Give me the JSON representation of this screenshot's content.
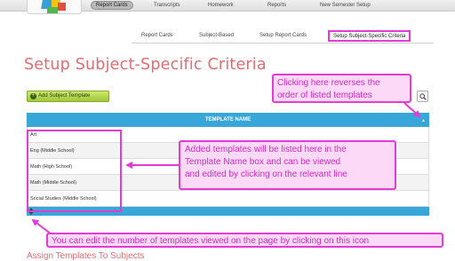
{
  "nav": {
    "items": [
      {
        "label": "Report Cards",
        "active": true
      },
      {
        "label": "Transcripts",
        "active": false
      },
      {
        "label": "Homework",
        "active": false
      },
      {
        "label": "Reports",
        "active": false
      },
      {
        "label": "New Semester Setup",
        "active": false
      }
    ]
  },
  "subnav": {
    "items": [
      {
        "label": "Report Cards",
        "active": false
      },
      {
        "label": "Subject-Based",
        "active": false
      },
      {
        "label": "Setup Report Cards",
        "active": false
      },
      {
        "label": "Setup Subject-Specific Criteria",
        "active": true
      }
    ]
  },
  "page": {
    "title": "Setup Subject-Specific Criteria",
    "add_button_label": "Add Subject Template",
    "next_heading": "Assign Templates To Subjects"
  },
  "table": {
    "header": "TEMPLATE NAME",
    "rows": [
      "Art",
      "Eng (Middle School)",
      "Math (High School)",
      "Math (Middle School)",
      "Social Studies (Middle School)"
    ]
  },
  "annotations": {
    "sort_note": [
      "Clicking here reverses the",
      "order of listed templates"
    ],
    "list_note": [
      "Added templates will be listed here in the",
      "Template Name box and can be viewed",
      "and edited by clicking on the relevant line"
    ],
    "pager_note": "You can edit the number of templates viewed on the page by clicking on this icon",
    "color": "#e43bd4"
  },
  "colors": {
    "accent": "#37a6d9",
    "title": "#e06d72",
    "button": "#b6d84a"
  },
  "icons": [
    "plus-icon",
    "search-icon",
    "sort-arrow-icon",
    "gear-icon"
  ]
}
